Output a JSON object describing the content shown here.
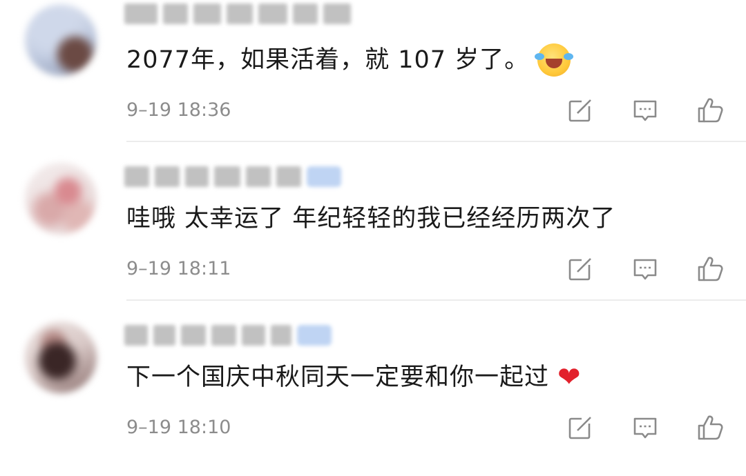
{
  "comments": [
    {
      "text": "2077年，如果活着，就 107 岁了。",
      "emoji": "face-with-tears-of-joy",
      "time": "9–19 18:36",
      "username_blurred": true,
      "has_badge": false
    },
    {
      "text": "哇哦 太幸运了 年纪轻轻的我已经经历两次了",
      "emoji": "",
      "time": "9–19 18:11",
      "username_blurred": true,
      "has_badge": true
    },
    {
      "text": "下一个国庆中秋同天一定要和你一起过",
      "emoji": "red-heart",
      "time": "9–19 18:10",
      "username_blurred": true,
      "has_badge": true
    }
  ],
  "icons": {
    "share": "share-icon",
    "reply": "comment-icon",
    "like": "thumbs-up-icon"
  },
  "colors": {
    "text": "#1a1a1a",
    "meta": "#8c8c8c",
    "icon": "#8a8a8a",
    "divider": "#ececec",
    "badge": "#a9c5ef",
    "heart": "#e2212c"
  }
}
